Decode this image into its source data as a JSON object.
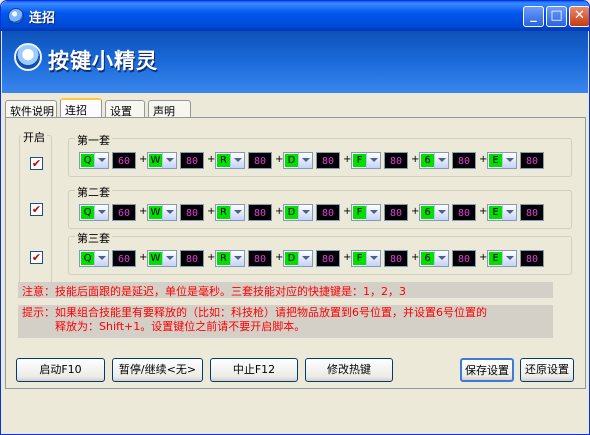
{
  "window": {
    "title": "连招"
  },
  "banner": {
    "logo_text": "按键小精灵"
  },
  "tabs": [
    {
      "label": "软件说明"
    },
    {
      "label": "连招"
    },
    {
      "label": "设置"
    },
    {
      "label": "声明"
    }
  ],
  "enable_group": {
    "title": "开启",
    "checks": [
      "✔",
      "✔",
      "✔"
    ]
  },
  "sets": [
    {
      "title": "第一套",
      "keys": [
        "Q",
        "W",
        "R",
        "D",
        "F",
        "6",
        "E"
      ],
      "delays": [
        "60",
        "80",
        "80",
        "80",
        "80",
        "80",
        "80"
      ]
    },
    {
      "title": "第二套",
      "keys": [
        "Q",
        "W",
        "R",
        "D",
        "F",
        "6",
        "E"
      ],
      "delays": [
        "60",
        "80",
        "80",
        "80",
        "80",
        "80",
        "80"
      ]
    },
    {
      "title": "第三套",
      "keys": [
        "Q",
        "W",
        "R",
        "D",
        "F",
        "6",
        "E"
      ],
      "delays": [
        "60",
        "80",
        "80",
        "80",
        "80",
        "80",
        "80"
      ]
    }
  ],
  "plus_sign": "+",
  "notes": {
    "note1": "注意：技能后面跟的是延迟，单位是毫秒。三套技能对应的快捷键是：1，2，3",
    "note2_line1": "提示：如果组合技能里有要释放的（比如：科技枪）请把物品放置到6号位置，并设置6号位置的",
    "note2_line2": "释放为：Shift+1。设置键位之前请不要开启脚本。"
  },
  "buttons": {
    "start": "启动F10",
    "pause": "暂停/继续<无>",
    "stop": "中止F12",
    "hotkey": "修改热键",
    "save": "保存设置",
    "restore": "还原设置"
  },
  "colors": {
    "key_bg": "#00E000",
    "delay_fg": "#E040E0",
    "note_fg": "#FF0000"
  }
}
